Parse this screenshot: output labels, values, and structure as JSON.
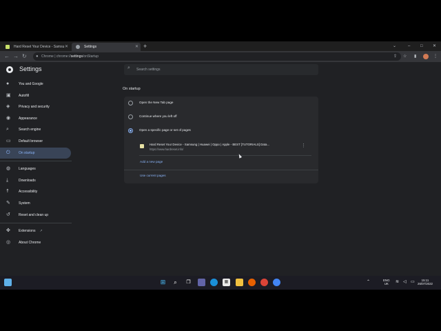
{
  "browser": {
    "tabs": [
      {
        "title": "Hard Reset Your Device - Samsu",
        "active": false
      },
      {
        "title": "Settings",
        "active": true
      }
    ],
    "new_tab": "+",
    "address": {
      "prefix": "Chrome",
      "separator": "|",
      "scheme": "chrome://",
      "host": "settings",
      "path": "/onStartup"
    },
    "window_controls": {
      "tab_search": "⌄",
      "minimize": "–",
      "maximize": "□",
      "close": "✕"
    }
  },
  "settings": {
    "title": "Settings",
    "search_placeholder": "Search settings",
    "nav": [
      {
        "label": "You and Google",
        "icon": "person-icon"
      },
      {
        "label": "Autofill",
        "icon": "key-icon"
      },
      {
        "label": "Privacy and security",
        "icon": "shield-icon"
      },
      {
        "label": "Appearance",
        "icon": "palette-icon"
      },
      {
        "label": "Search engine",
        "icon": "search-icon"
      },
      {
        "label": "Default browser",
        "icon": "browser-icon"
      },
      {
        "label": "On startup",
        "icon": "power-icon",
        "active": true
      },
      {
        "label": "Languages",
        "icon": "globe-icon"
      },
      {
        "label": "Downloads",
        "icon": "download-icon"
      },
      {
        "label": "Accessibility",
        "icon": "accessibility-icon"
      },
      {
        "label": "System",
        "icon": "wrench-icon"
      },
      {
        "label": "Reset and clean up",
        "icon": "reset-icon"
      },
      {
        "label": "Extensions",
        "icon": "puzzle-icon"
      },
      {
        "label": "About Chrome",
        "icon": "chrome-icon"
      }
    ],
    "section_title": "On startup",
    "options": [
      {
        "label": "Open the New Tab page",
        "selected": false
      },
      {
        "label": "Continue where you left off",
        "selected": false
      },
      {
        "label": "Open a specific page or set of pages",
        "selected": true
      }
    ],
    "pages": [
      {
        "title": "Hard Reset Your Device - Samsung | Huawei | Oppo | Apple - BEST [TUTORIALS] Data...",
        "url": "https://www.hardreset.info/"
      }
    ],
    "add_new_page": "Add a new page",
    "use_current_pages": "Use current pages"
  },
  "taskbar": {
    "language": "ENG",
    "region": "UK",
    "time": "15:11",
    "date": "26/07/2022"
  },
  "colors": {
    "accent": "#8ab4f8",
    "background": "#202124",
    "card": "#292a2d",
    "active_nav": "#394457"
  }
}
